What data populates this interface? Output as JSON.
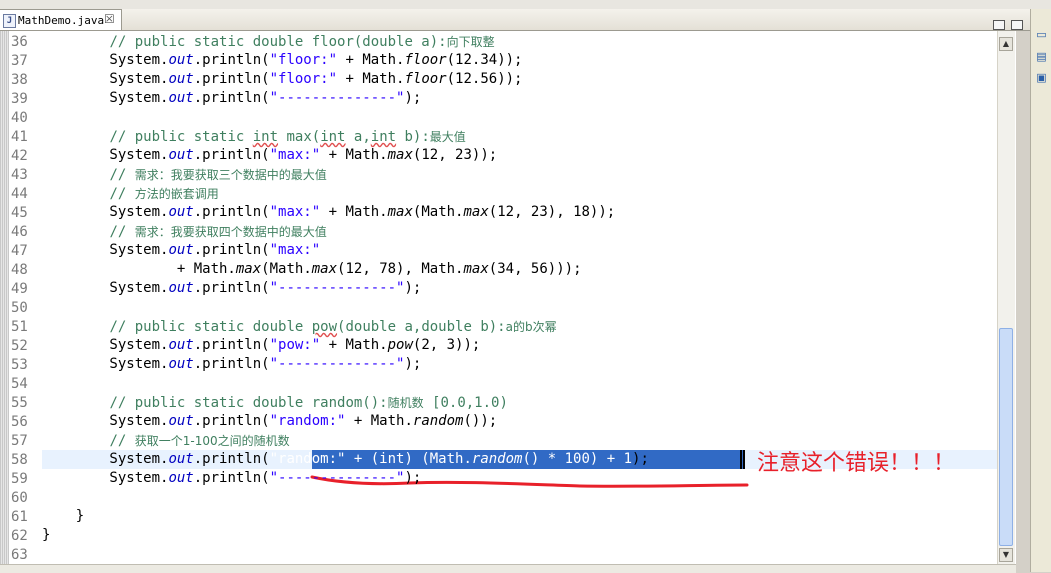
{
  "tab": {
    "label": "MathDemo.java",
    "icon_letter": "J",
    "close_glyph": "☒"
  },
  "icons": {
    "file": "java-file-icon",
    "close": "close-icon",
    "minimize": "minimize-icon",
    "maximize": "maximize-icon"
  },
  "colors": {
    "comment": "#3f7f5f",
    "string": "#2a00ff",
    "static_field": "#0000c0",
    "selection": "#316ac5",
    "annotation": "#e8202a"
  },
  "lines": [
    {
      "n": "36",
      "segs": [
        {
          "t": "        "
        },
        {
          "t": "// public static double floor(double a):",
          "c": "cm"
        },
        {
          "t": "向下取整",
          "c": "cm zh"
        }
      ]
    },
    {
      "n": "37",
      "segs": [
        {
          "t": "        System."
        },
        {
          "t": "out",
          "c": "fld"
        },
        {
          "t": ".println("
        },
        {
          "t": "\"floor:\"",
          "c": "st"
        },
        {
          "t": " + Math."
        },
        {
          "t": "floor",
          "c": "it"
        },
        {
          "t": "(12.34));"
        }
      ]
    },
    {
      "n": "38",
      "segs": [
        {
          "t": "        System."
        },
        {
          "t": "out",
          "c": "fld"
        },
        {
          "t": ".println("
        },
        {
          "t": "\"floor:\"",
          "c": "st"
        },
        {
          "t": " + Math."
        },
        {
          "t": "floor",
          "c": "it"
        },
        {
          "t": "(12.56));"
        }
      ]
    },
    {
      "n": "39",
      "segs": [
        {
          "t": "        System."
        },
        {
          "t": "out",
          "c": "fld"
        },
        {
          "t": ".println("
        },
        {
          "t": "\"--------------\"",
          "c": "st"
        },
        {
          "t": ");"
        }
      ]
    },
    {
      "n": "40",
      "segs": [
        {
          "t": ""
        }
      ]
    },
    {
      "n": "41",
      "segs": [
        {
          "t": "        "
        },
        {
          "t": "// public static ",
          "c": "cm"
        },
        {
          "t": "int",
          "c": "cm squig"
        },
        {
          "t": " max(",
          "c": "cm"
        },
        {
          "t": "int",
          "c": "cm squig"
        },
        {
          "t": " a,",
          "c": "cm"
        },
        {
          "t": "int",
          "c": "cm squig"
        },
        {
          "t": " b):",
          "c": "cm"
        },
        {
          "t": "最大值",
          "c": "cm zh"
        }
      ]
    },
    {
      "n": "42",
      "segs": [
        {
          "t": "        System."
        },
        {
          "t": "out",
          "c": "fld"
        },
        {
          "t": ".println("
        },
        {
          "t": "\"max:\"",
          "c": "st"
        },
        {
          "t": " + Math."
        },
        {
          "t": "max",
          "c": "it"
        },
        {
          "t": "(12, 23));"
        }
      ]
    },
    {
      "n": "43",
      "segs": [
        {
          "t": "        "
        },
        {
          "t": "// ",
          "c": "cm"
        },
        {
          "t": "需求：我要获取三个数据中的最大值",
          "c": "cm zh"
        }
      ]
    },
    {
      "n": "44",
      "segs": [
        {
          "t": "        "
        },
        {
          "t": "// ",
          "c": "cm"
        },
        {
          "t": "方法的嵌套调用",
          "c": "cm zh"
        }
      ]
    },
    {
      "n": "45",
      "segs": [
        {
          "t": "        System."
        },
        {
          "t": "out",
          "c": "fld"
        },
        {
          "t": ".println("
        },
        {
          "t": "\"max:\"",
          "c": "st"
        },
        {
          "t": " + Math."
        },
        {
          "t": "max",
          "c": "it"
        },
        {
          "t": "(Math."
        },
        {
          "t": "max",
          "c": "it"
        },
        {
          "t": "(12, 23), 18));"
        }
      ]
    },
    {
      "n": "46",
      "segs": [
        {
          "t": "        "
        },
        {
          "t": "// ",
          "c": "cm"
        },
        {
          "t": "需求：我要获取四个数据中的最大值",
          "c": "cm zh"
        }
      ]
    },
    {
      "n": "47",
      "segs": [
        {
          "t": "        System."
        },
        {
          "t": "out",
          "c": "fld"
        },
        {
          "t": ".println("
        },
        {
          "t": "\"max:\"",
          "c": "st"
        }
      ]
    },
    {
      "n": "48",
      "segs": [
        {
          "t": "                + Math."
        },
        {
          "t": "max",
          "c": "it"
        },
        {
          "t": "(Math."
        },
        {
          "t": "max",
          "c": "it"
        },
        {
          "t": "(12, 78), Math."
        },
        {
          "t": "max",
          "c": "it"
        },
        {
          "t": "(34, 56)));"
        }
      ]
    },
    {
      "n": "49",
      "segs": [
        {
          "t": "        System."
        },
        {
          "t": "out",
          "c": "fld"
        },
        {
          "t": ".println("
        },
        {
          "t": "\"--------------\"",
          "c": "st"
        },
        {
          "t": ");"
        }
      ]
    },
    {
      "n": "50",
      "segs": [
        {
          "t": ""
        }
      ]
    },
    {
      "n": "51",
      "segs": [
        {
          "t": "        "
        },
        {
          "t": "// public static double ",
          "c": "cm"
        },
        {
          "t": "pow",
          "c": "cm squig"
        },
        {
          "t": "(double a,double b):",
          "c": "cm"
        },
        {
          "t": "a的b次幂",
          "c": "cm zh"
        }
      ]
    },
    {
      "n": "52",
      "segs": [
        {
          "t": "        System."
        },
        {
          "t": "out",
          "c": "fld"
        },
        {
          "t": ".println("
        },
        {
          "t": "\"pow:\"",
          "c": "st"
        },
        {
          "t": " + Math."
        },
        {
          "t": "pow",
          "c": "it"
        },
        {
          "t": "(2, 3));"
        }
      ]
    },
    {
      "n": "53",
      "segs": [
        {
          "t": "        System."
        },
        {
          "t": "out",
          "c": "fld"
        },
        {
          "t": ".println("
        },
        {
          "t": "\"--------------\"",
          "c": "st"
        },
        {
          "t": ");"
        }
      ]
    },
    {
      "n": "54",
      "segs": [
        {
          "t": ""
        }
      ]
    },
    {
      "n": "55",
      "segs": [
        {
          "t": "        "
        },
        {
          "t": "// public static double random():",
          "c": "cm"
        },
        {
          "t": "随机数",
          "c": "cm zh"
        },
        {
          "t": " [0.0,1.0)",
          "c": "cm"
        }
      ]
    },
    {
      "n": "56",
      "segs": [
        {
          "t": "        System."
        },
        {
          "t": "out",
          "c": "fld"
        },
        {
          "t": ".println("
        },
        {
          "t": "\"random:\"",
          "c": "st"
        },
        {
          "t": " + Math."
        },
        {
          "t": "random",
          "c": "it"
        },
        {
          "t": "());"
        }
      ]
    },
    {
      "n": "57",
      "segs": [
        {
          "t": "        "
        },
        {
          "t": "// ",
          "c": "cm"
        },
        {
          "t": "获取一个1-100之间的随机数",
          "c": "cm zh"
        }
      ]
    },
    {
      "n": "58",
      "segs": [
        {
          "t": "        System."
        },
        {
          "t": "out",
          "c": "fld"
        },
        {
          "t": ".println("
        },
        {
          "t": "\"random:\"",
          "c": "sel-text"
        },
        {
          "t": " + (int) (Math.",
          "c": "sel-text"
        },
        {
          "t": "random",
          "c": "sel-text it"
        },
        {
          "t": "() * 100) + 1",
          "c": "sel-text"
        },
        {
          "t": ");"
        }
      ]
    },
    {
      "n": "59",
      "segs": [
        {
          "t": "        System."
        },
        {
          "t": "out",
          "c": "fld"
        },
        {
          "t": ".println("
        },
        {
          "t": "\"--------------\"",
          "c": "st"
        },
        {
          "t": ");"
        }
      ]
    },
    {
      "n": "60",
      "segs": [
        {
          "t": ""
        }
      ]
    },
    {
      "n": "61",
      "segs": [
        {
          "t": "    }"
        }
      ]
    },
    {
      "n": "62",
      "segs": [
        {
          "t": "}"
        }
      ]
    },
    {
      "n": "63",
      "segs": [
        {
          "t": ""
        }
      ]
    }
  ],
  "annotation": "注意这个错误！！！",
  "scroll": {
    "up": "▲",
    "down": "▼"
  }
}
